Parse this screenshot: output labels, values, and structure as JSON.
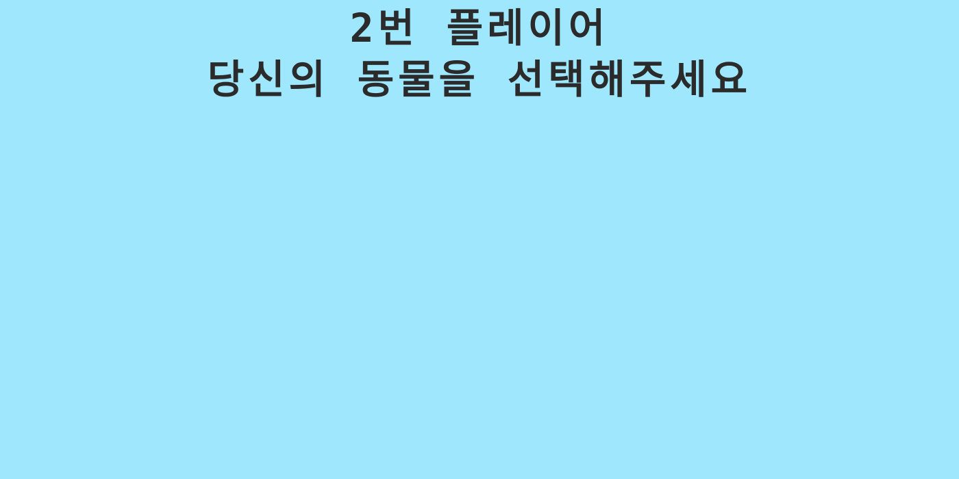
{
  "prompt": {
    "line1": "2번 플레이어",
    "line2": "당신의 동물을 선택해주세요"
  },
  "colors": {
    "background": "#9ee7fd",
    "text": "#2b2b2b"
  }
}
